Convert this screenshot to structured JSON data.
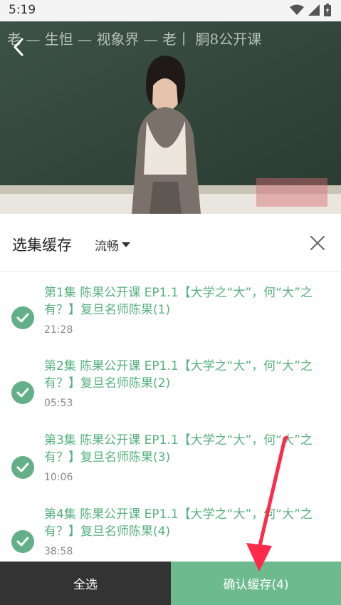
{
  "status_bar": {
    "time": "5:19"
  },
  "video": {
    "blackboard_text": "老 — 生怛 — 视象界 — 老丨 胴8公开课"
  },
  "panel": {
    "title": "选集缓存",
    "quality": "流畅"
  },
  "episodes": [
    {
      "title": "第1集 陈果公开课 EP1.1【大学之“大”，何“大”之有？】复旦名师陈果(1)",
      "duration": "21:28",
      "checked": true
    },
    {
      "title": "第2集 陈果公开课 EP1.1【大学之“大”，何“大”之有？】复旦名师陈果(2)",
      "duration": "05:53",
      "checked": true
    },
    {
      "title": "第3集 陈果公开课 EP1.1【大学之“大”，何“大”之有？】复旦名师陈果(3)",
      "duration": "10:06",
      "checked": true
    },
    {
      "title": "第4集 陈果公开课 EP1.1【大学之“大”，何“大”之有？】复旦名师陈果(4)",
      "duration": "38:58",
      "checked": true
    }
  ],
  "bottom": {
    "select_all": "全选",
    "confirm": "确认缓存(4)"
  },
  "colors": {
    "accent_green": "#63b088",
    "confirm_bg": "#6dba8e",
    "select_all_bg": "#333333",
    "annotation_arrow": "#ff2a4a"
  }
}
